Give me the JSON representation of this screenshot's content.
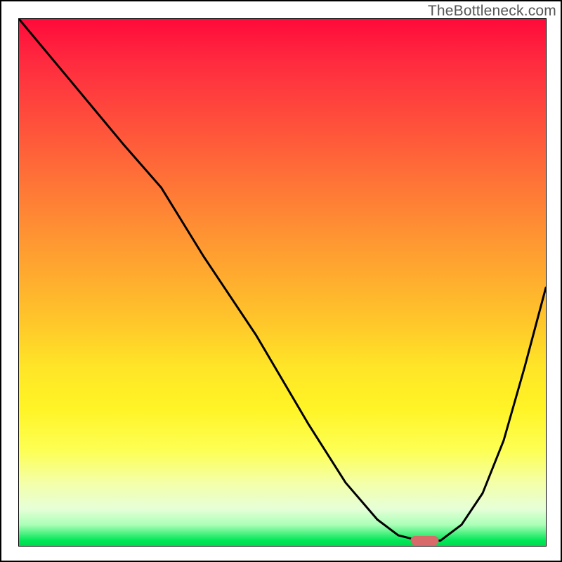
{
  "watermark": {
    "text": "TheBottleneck.com"
  },
  "chart_data": {
    "type": "line",
    "title": "",
    "xlabel": "",
    "ylabel": "",
    "xlim": [
      0,
      100
    ],
    "ylim": [
      0,
      100
    ],
    "grid": false,
    "legend": false,
    "background": "vertical-gradient-red-to-green",
    "series": [
      {
        "name": "bottleneck-curve",
        "x": [
          0,
          10,
          20,
          27,
          35,
          45,
          55,
          62,
          68,
          72,
          76,
          80,
          84,
          88,
          92,
          96,
          100
        ],
        "y": [
          100,
          88,
          76,
          68,
          55,
          40,
          23,
          12,
          5,
          2,
          1,
          1,
          4,
          10,
          20,
          34,
          49
        ]
      }
    ],
    "marker": {
      "name": "optimal-marker",
      "x": 77,
      "y": 1,
      "color": "#d86a6a",
      "shape": "pill"
    }
  }
}
